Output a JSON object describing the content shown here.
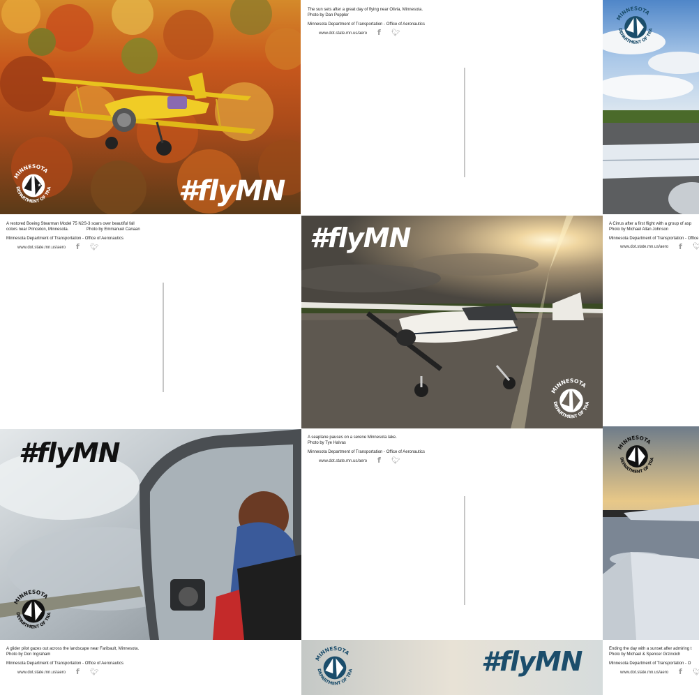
{
  "hashtag": "#flyMN",
  "seal": {
    "ring_top": "MINNESOTA",
    "ring_bottom": "DEPARTMENT OF TRANSPORTATION"
  },
  "back_common": {
    "org": "Minnesota Department of Transportation - Office of Aeronautics",
    "website": "www.dot.state.mn.us/aero"
  },
  "cards": {
    "olivia": {
      "caption_1": "The sun sets after a great day of flying near Olivia, Minnesota.",
      "caption_2": "Photo by Dan Poppler"
    },
    "stearman": {
      "caption_1": "A restored Boeing Stearman Model 75 N2S-3 soars over beautiful fall",
      "caption_2": "colors near Princeton, Minnesota.",
      "caption_3": "Photo by Emmanuel Canaan"
    },
    "cirrus": {
      "caption_1": "A Cirrus after a first flight with a group of asp",
      "caption_2": "Photo by Michael Allan Johnson"
    },
    "seaplane": {
      "caption_1": "A seaplane pauses on a serene Minnesota lake.",
      "caption_2": "Photo by Tye Halvas"
    },
    "glider": {
      "caption_1": "A glider pilot gazes out across the landscape near Faribault, Minnesota.",
      "caption_2": "Photo by Don Ingraham"
    },
    "sunset": {
      "caption_1": "Ending the day with a sunset after admiring t",
      "caption_2": "Photo by Michael & Spencer Grzincich",
      "org_cropped": "Minnesota Department of Transportation - O"
    }
  },
  "colors": {
    "seal_blue": "#1b4d6b",
    "tag_white": "#ffffff",
    "tag_black": "#111111",
    "tag_navy": "#1b4d6b",
    "icon_gray": "#9a9a9a",
    "divider_gray": "#c6c6c6"
  }
}
